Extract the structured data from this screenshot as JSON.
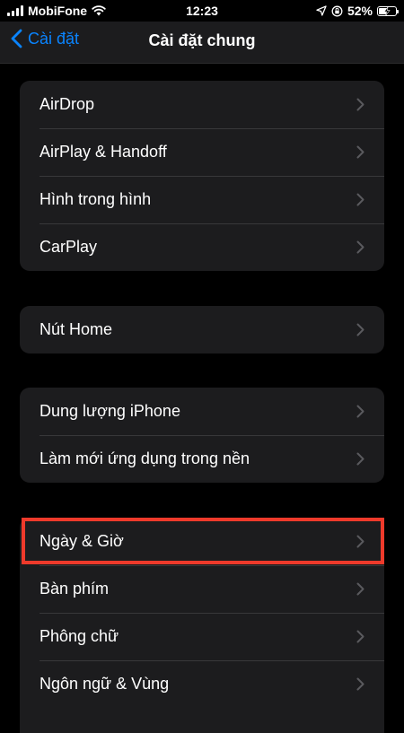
{
  "status_bar": {
    "carrier": "MobiFone",
    "time": "12:23",
    "battery": "52%",
    "battery_level": 0.52
  },
  "nav": {
    "back_label": "Cài đặt",
    "title": "Cài đặt chung"
  },
  "groups": [
    {
      "items": [
        {
          "label": "AirDrop"
        },
        {
          "label": "AirPlay & Handoff"
        },
        {
          "label": "Hình trong hình"
        },
        {
          "label": "CarPlay"
        }
      ]
    },
    {
      "items": [
        {
          "label": "Nút Home"
        }
      ]
    },
    {
      "items": [
        {
          "label": "Dung lượng iPhone"
        },
        {
          "label": "Làm mới ứng dụng trong nền"
        }
      ]
    },
    {
      "items": [
        {
          "label": "Ngày & Giờ"
        },
        {
          "label": "Bàn phím"
        },
        {
          "label": "Phông chữ"
        },
        {
          "label": "Ngôn ngữ & Vùng"
        }
      ]
    }
  ],
  "colors": {
    "accent": "#0a84ff",
    "highlight": "#ee3a2b",
    "cell_background": "#1c1c1e"
  },
  "icons": [
    "chevron-left-icon",
    "chevron-right-icon",
    "wifi-icon",
    "location-arrow-icon",
    "orientation-lock-icon",
    "battery-icon"
  ]
}
